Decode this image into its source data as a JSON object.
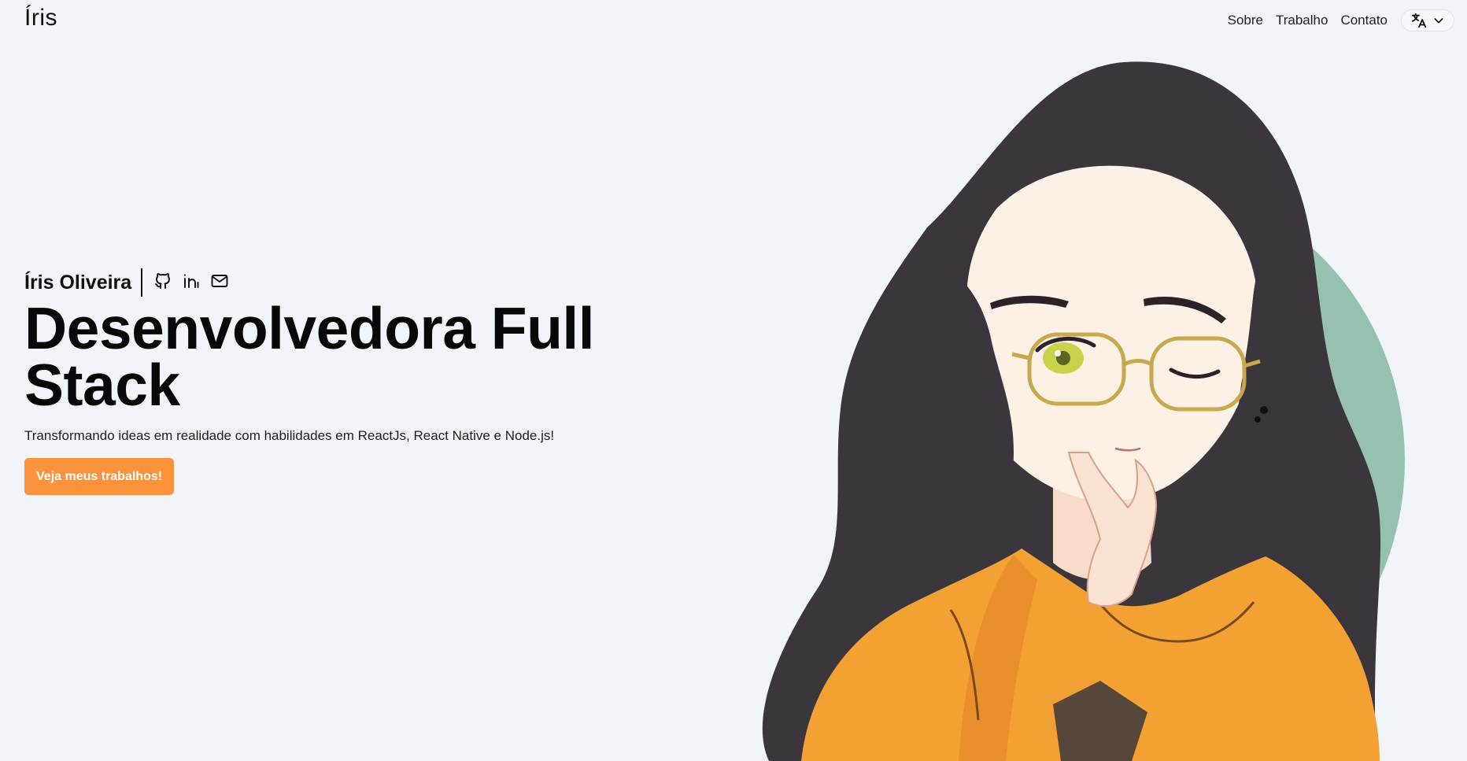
{
  "header": {
    "logo": "Íris",
    "nav": [
      "Sobre",
      "Trabalho",
      "Contato"
    ],
    "language_icon": "translate-icon",
    "language_chevron": "chevron-down-icon"
  },
  "hero": {
    "name": "Íris Oliveira",
    "social": [
      {
        "icon": "github-icon"
      },
      {
        "icon": "linkedin-icon"
      },
      {
        "icon": "mail-icon"
      }
    ],
    "headline_line1": "Desenvolvedora Full",
    "headline_line2": "Stack",
    "subtitle": "Transformando ideas em realidade com habilidades em ReactJs, React Native e Node.js!",
    "cta_label": "Veja meus trabalhos!"
  },
  "illustration": {
    "subject": "avatar-illustration",
    "colors": {
      "circle": "#95c1ae",
      "hair": "#3b363c",
      "skin": "#fdf0e4",
      "hoodie": "#f3a133",
      "glasses": "#c7a84c",
      "eye": "#c8d24a"
    }
  },
  "colors": {
    "background": "#f1f4f9",
    "accent": "#fb923c",
    "text": "#0a0a0a"
  }
}
